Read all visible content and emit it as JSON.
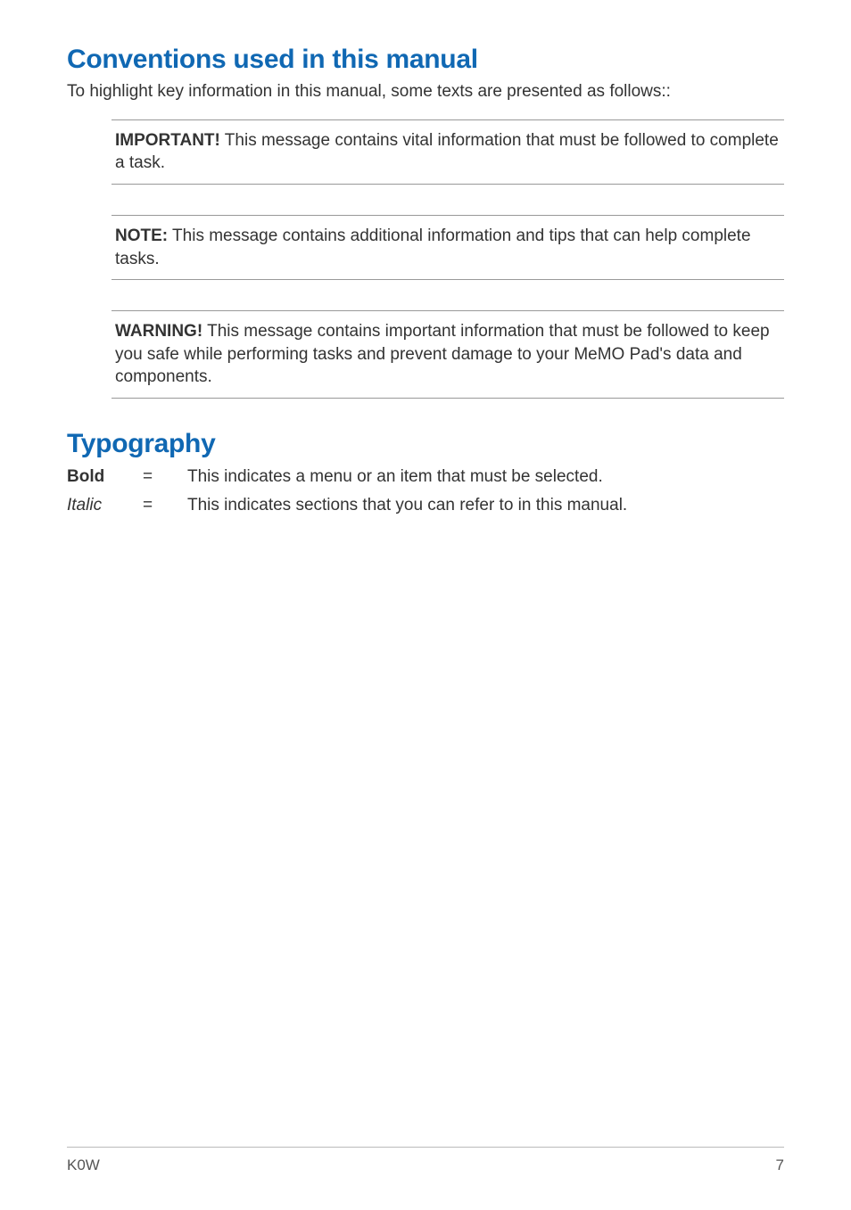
{
  "headings": {
    "conventions": "Conventions used in this manual",
    "typography": "Typography"
  },
  "intro": "To highlight key information in this manual, some texts are presented as follows::",
  "notes": {
    "important": {
      "label": "IMPORTANT!",
      "text": "  This message contains vital information that must be followed to complete a task."
    },
    "note": {
      "label": "NOTE:",
      "text": "  This message contains additional information and tips that can help complete tasks."
    },
    "warning": {
      "label": "WARNING!",
      "text": "  This message contains important information that must be followed to keep you safe while performing tasks and prevent damage to your MeMO Pad's data and components."
    }
  },
  "typography": {
    "bold": {
      "label": "Bold",
      "equals": "=",
      "desc": "This indicates a menu or an item that must be selected."
    },
    "italic": {
      "label": "Italic",
      "equals": "=",
      "desc": "This indicates sections that you can refer to in this manual."
    }
  },
  "footer": {
    "left": "K0W",
    "right": "7"
  }
}
